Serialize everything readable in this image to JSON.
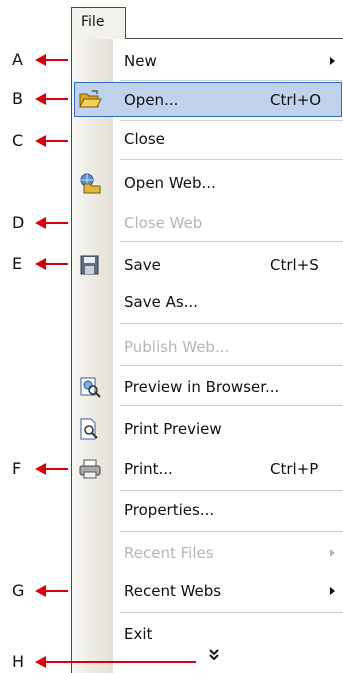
{
  "menu": {
    "title": "File",
    "items": [
      {
        "label": "New",
        "shortcut": "",
        "submenu": true,
        "enabled": true,
        "icon": ""
      },
      {
        "label": "Open...",
        "shortcut": "Ctrl+O",
        "submenu": false,
        "enabled": true,
        "icon": "open-folder-icon",
        "highlighted": true
      },
      {
        "label": "Close",
        "shortcut": "",
        "submenu": false,
        "enabled": true,
        "icon": ""
      },
      {
        "label": "Open Web...",
        "shortcut": "",
        "submenu": false,
        "enabled": true,
        "icon": "open-web-icon"
      },
      {
        "label": "Close Web",
        "shortcut": "",
        "submenu": false,
        "enabled": false,
        "icon": ""
      },
      {
        "label": "Save",
        "shortcut": "Ctrl+S",
        "submenu": false,
        "enabled": true,
        "icon": "floppy-disk-icon"
      },
      {
        "label": "Save As...",
        "shortcut": "",
        "submenu": false,
        "enabled": true,
        "icon": ""
      },
      {
        "label": "Publish Web...",
        "shortcut": "",
        "submenu": false,
        "enabled": false,
        "icon": ""
      },
      {
        "label": "Preview in Browser...",
        "shortcut": "",
        "submenu": false,
        "enabled": true,
        "icon": "preview-browser-icon"
      },
      {
        "label": "Print Preview",
        "shortcut": "",
        "submenu": false,
        "enabled": true,
        "icon": "print-preview-icon"
      },
      {
        "label": "Print...",
        "shortcut": "Ctrl+P",
        "submenu": false,
        "enabled": true,
        "icon": "printer-icon"
      },
      {
        "label": "Properties...",
        "shortcut": "",
        "submenu": false,
        "enabled": true,
        "icon": ""
      },
      {
        "label": "Recent Files",
        "shortcut": "",
        "submenu": true,
        "enabled": false,
        "icon": ""
      },
      {
        "label": "Recent Webs",
        "shortcut": "",
        "submenu": true,
        "enabled": true,
        "icon": ""
      },
      {
        "label": "Exit",
        "shortcut": "",
        "submenu": false,
        "enabled": true,
        "icon": ""
      }
    ],
    "expand_icon": "double-chevron-down-icon"
  },
  "annotations": [
    "A",
    "B",
    "C",
    "D",
    "E",
    "F",
    "G",
    "H"
  ],
  "colors": {
    "highlight": "#c1d2ee",
    "highlight_border": "#316ac5",
    "arrow": "#d8000c",
    "disabled_text": "#b5b5b5"
  }
}
